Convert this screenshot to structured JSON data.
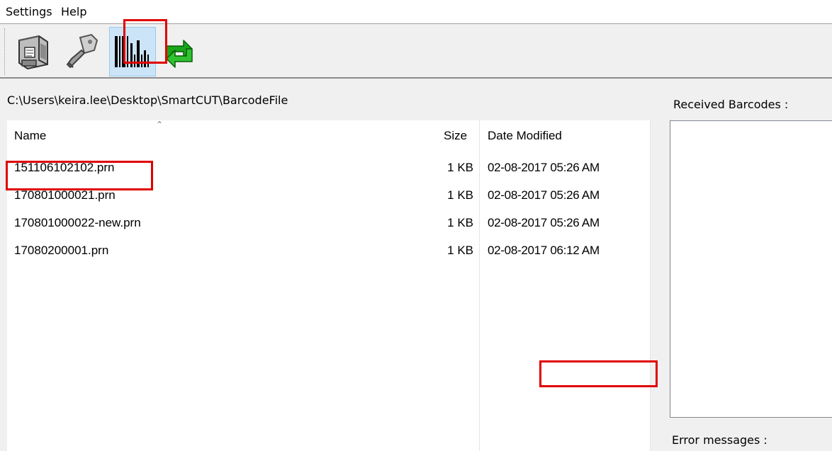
{
  "menu": {
    "settings": "Settings",
    "help": "Help"
  },
  "toolbar": {
    "buttons": [
      {
        "icon": "printer-icon",
        "pressed": false
      },
      {
        "icon": "knife-icon",
        "pressed": false
      },
      {
        "icon": "barcode-icon",
        "pressed": true
      },
      {
        "icon": "refresh-icon",
        "pressed": false
      }
    ]
  },
  "path": "C:\\Users\\keira.lee\\Desktop\\SmartCUT\\BarcodeFile",
  "file_list": {
    "columns": {
      "name": "Name",
      "size": "Size",
      "date": "Date Modified"
    },
    "rows": [
      {
        "name": "151106102102.prn",
        "size": "1 KB",
        "date": "02-08-2017 05:26 AM"
      },
      {
        "name": "170801000021.prn",
        "size": "1 KB",
        "date": "02-08-2017 05:26 AM"
      },
      {
        "name": "170801000022-new.prn",
        "size": "1 KB",
        "date": "02-08-2017 05:26 AM"
      },
      {
        "name": "17080200001.prn",
        "size": "1 KB",
        "date": "02-08-2017 06:12 AM"
      }
    ]
  },
  "received_barcodes_label": "Received Barcodes :",
  "error_messages_label": "Error messages :",
  "colors": {
    "annotation": "#e00000",
    "pressed_bg": "#cce4f7"
  }
}
